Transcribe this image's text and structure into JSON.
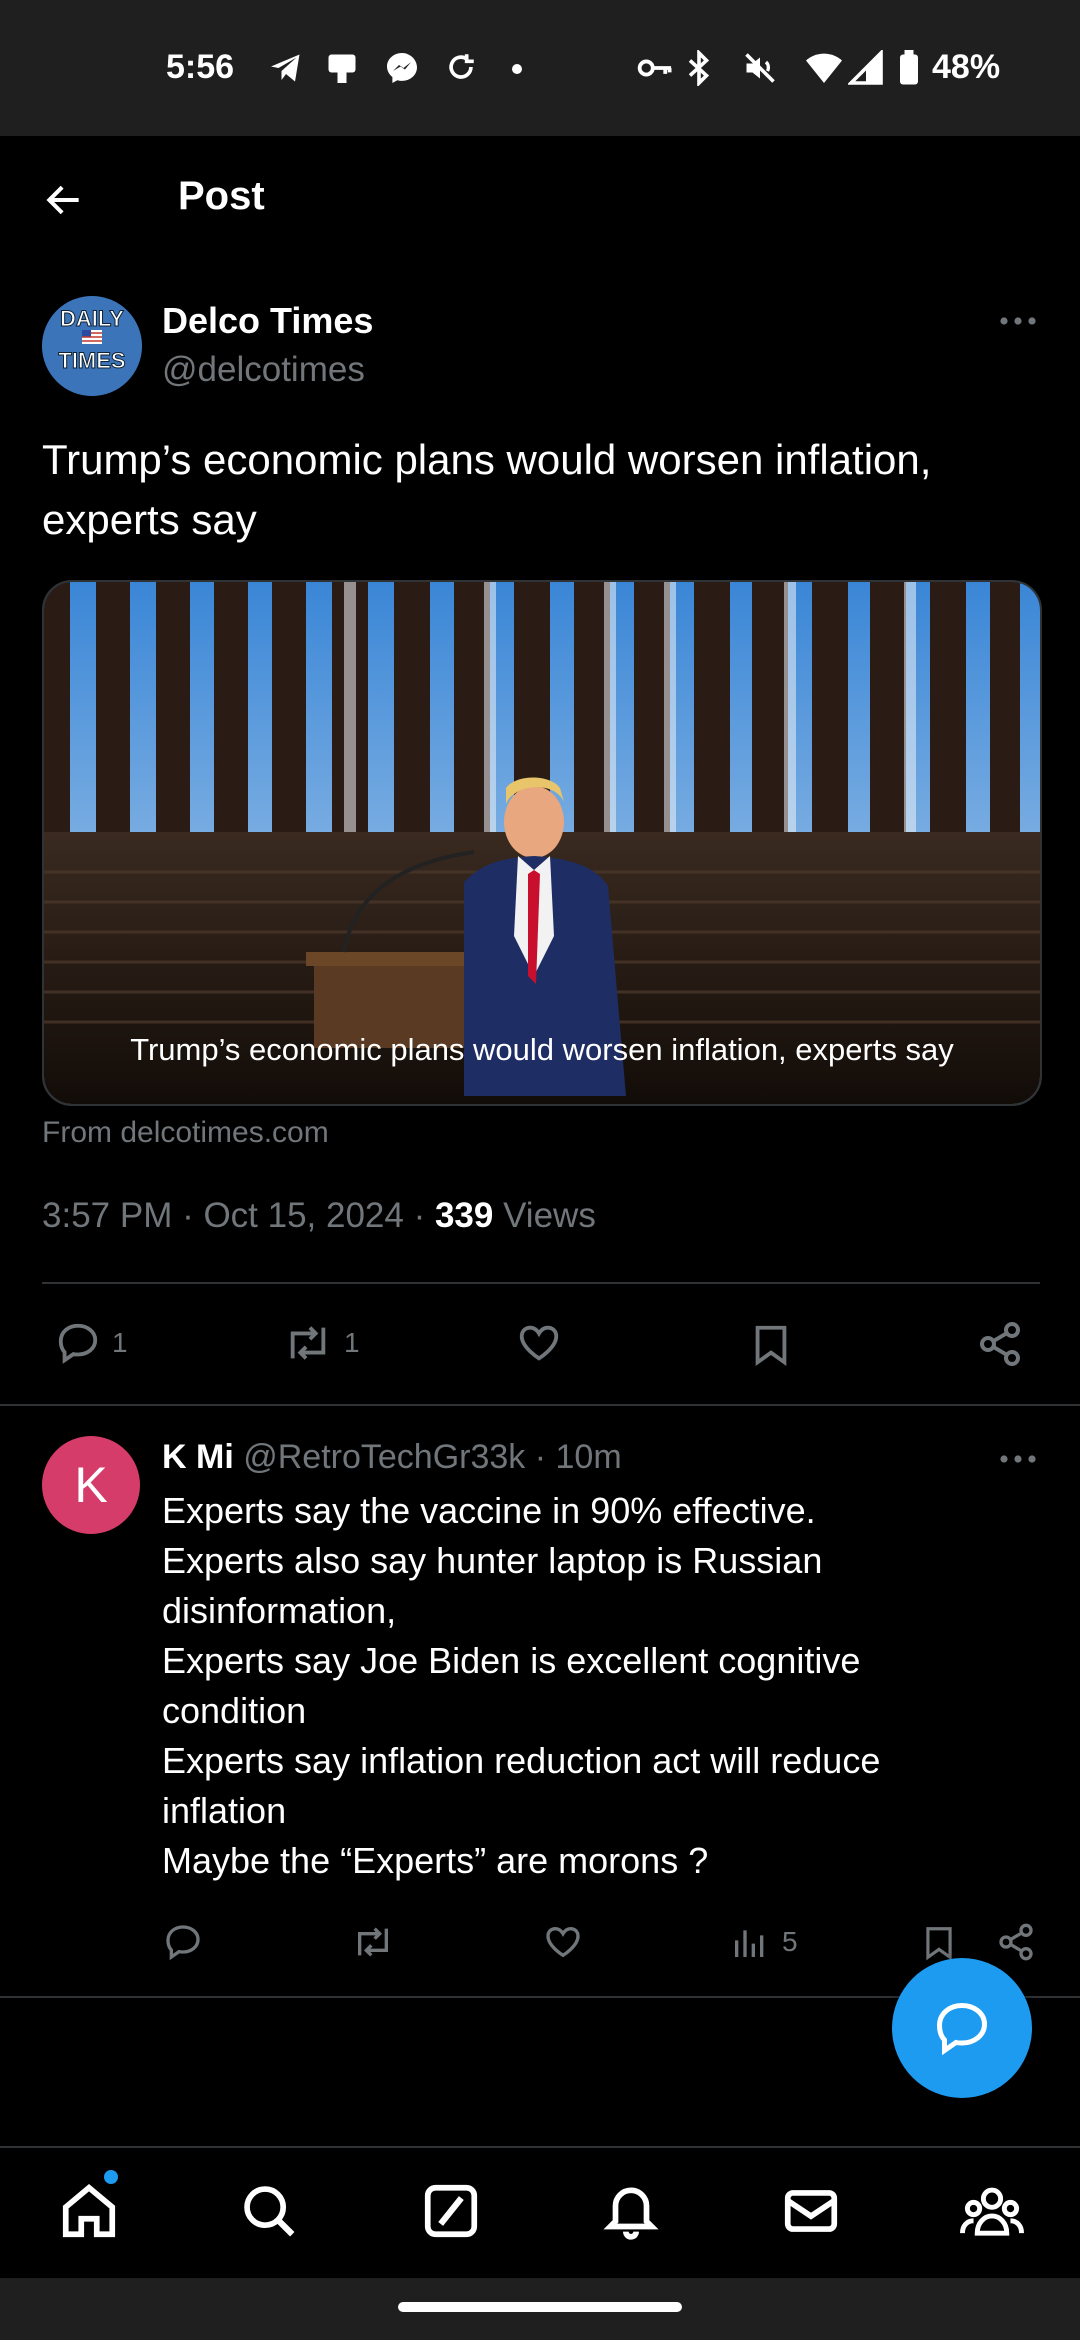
{
  "status_bar": {
    "time": "5:56",
    "battery": "48%"
  },
  "header": {
    "title": "Post"
  },
  "post": {
    "author_name": "Delco Times",
    "author_handle": "@delcotimes",
    "avatar_text_top": "DAILY",
    "avatar_text_bottom": "TIMES",
    "text": "Trump’s economic plans would worsen inflation, experts say",
    "card_caption": "Trump’s economic plans would worsen inflation, experts say",
    "card_source": "From delcotimes.com",
    "timestamp": "3:57 PM · Oct 15, 2024 · ",
    "views_count": "339",
    "views_label": " Views",
    "actions": {
      "replies": "1",
      "reposts": "1"
    }
  },
  "reply": {
    "avatar_letter": "K",
    "name": "K Mi",
    "handle_time": " @RetroTechGr33k · 10m",
    "text": "Experts say the vaccine in 90% effective.\nExperts also say hunter laptop is Russian disinformation,\nExperts say Joe Biden is excellent cognitive condition\nExperts say inflation reduction act will reduce inflation\nMaybe the “Experts” are morons ?",
    "actions": {
      "views": "5"
    }
  },
  "colors": {
    "accent": "#1d9bf0",
    "muted": "#71767b",
    "divider": "#2f3336",
    "reply_avatar": "#d63c6a"
  },
  "icons": [
    "back-arrow-icon",
    "more-icon",
    "reply-icon",
    "repost-icon",
    "like-icon",
    "bookmark-icon",
    "share-icon",
    "views-icon",
    "compose-reply-icon",
    "home-icon",
    "search-icon",
    "grok-icon",
    "bell-icon",
    "mail-icon",
    "communities-icon"
  ]
}
